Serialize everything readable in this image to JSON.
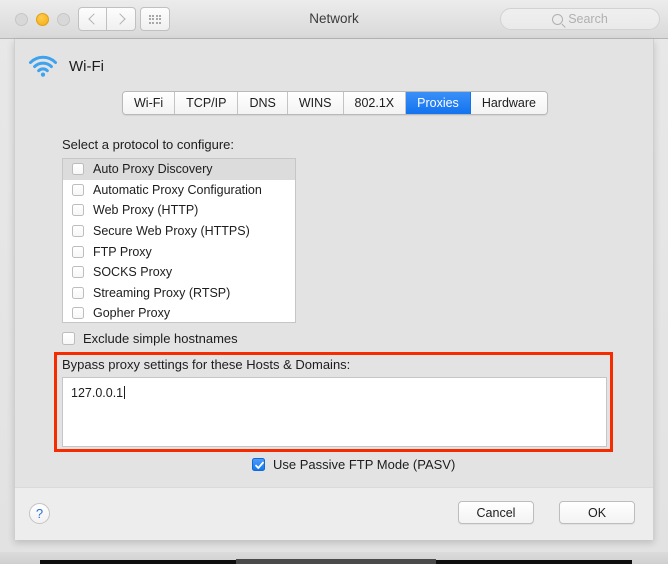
{
  "window": {
    "title": "Network",
    "traffic_lights": [
      {
        "name": "close",
        "state": "disabled",
        "color": "#d8d8d8"
      },
      {
        "name": "minimize",
        "state": "active",
        "color": "#f4ad12"
      },
      {
        "name": "zoom",
        "state": "disabled",
        "color": "#d8d8d8"
      }
    ],
    "nav": {
      "back": "‹",
      "forward": "›",
      "show_all": "grid-icon"
    },
    "search": {
      "placeholder": "Search",
      "value": ""
    }
  },
  "service": {
    "icon": "wifi-icon",
    "name": "Wi-Fi"
  },
  "tabs": [
    {
      "label": "Wi-Fi",
      "active": false
    },
    {
      "label": "TCP/IP",
      "active": false
    },
    {
      "label": "DNS",
      "active": false
    },
    {
      "label": "WINS",
      "active": false
    },
    {
      "label": "802.1X",
      "active": false
    },
    {
      "label": "Proxies",
      "active": true
    },
    {
      "label": "Hardware",
      "active": false
    }
  ],
  "proxies": {
    "section_label": "Select a protocol to configure:",
    "protocols": [
      {
        "label": "Auto Proxy Discovery",
        "checked": false,
        "selected": true
      },
      {
        "label": "Automatic Proxy Configuration",
        "checked": false,
        "selected": false
      },
      {
        "label": "Web Proxy (HTTP)",
        "checked": false,
        "selected": false
      },
      {
        "label": "Secure Web Proxy (HTTPS)",
        "checked": false,
        "selected": false
      },
      {
        "label": "FTP Proxy",
        "checked": false,
        "selected": false
      },
      {
        "label": "SOCKS Proxy",
        "checked": false,
        "selected": false
      },
      {
        "label": "Streaming Proxy (RTSP)",
        "checked": false,
        "selected": false
      },
      {
        "label": "Gopher Proxy",
        "checked": false,
        "selected": false
      }
    ],
    "exclude_simple_hostnames": {
      "label": "Exclude simple hostnames",
      "checked": false
    },
    "bypass": {
      "label": "Bypass proxy settings for these Hosts & Domains:",
      "value": "127.0.0.1"
    },
    "passive_ftp": {
      "label": "Use Passive FTP Mode (PASV)",
      "checked": true
    }
  },
  "annotation": {
    "color": "#f62b00",
    "shape": "rectangle"
  },
  "footer": {
    "help_label": "?",
    "cancel_label": "Cancel",
    "ok_label": "OK"
  }
}
